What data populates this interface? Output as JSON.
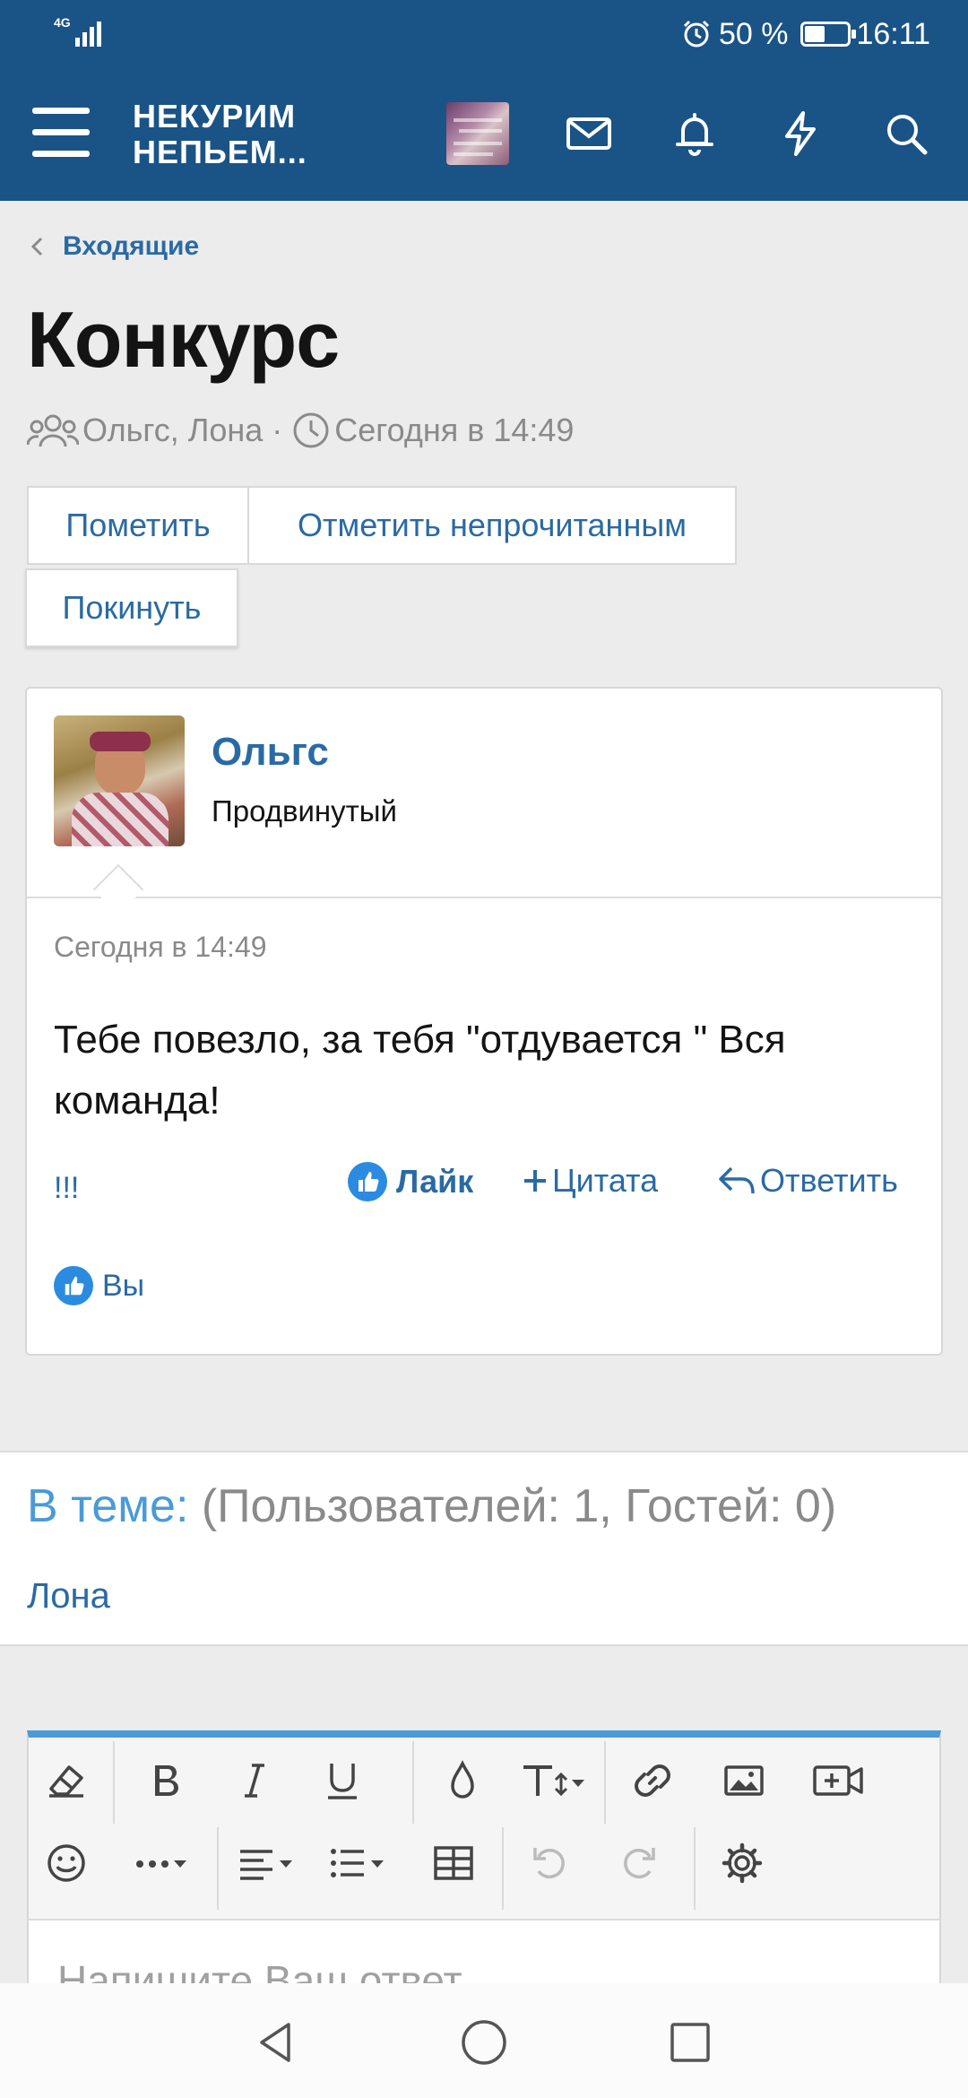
{
  "status_bar": {
    "network": "4G",
    "battery": "50 %",
    "time": "16:11"
  },
  "header": {
    "logo_line1": "НЕКУРИМ",
    "logo_line2": "НЕПЬЕМ...",
    "icons": [
      "menu-icon",
      "avatar",
      "envelope-icon",
      "bell-icon",
      "bolt-icon",
      "search-icon"
    ],
    "accent": "#1a5386"
  },
  "breadcrumb": {
    "label": "Входящие"
  },
  "conversation": {
    "title": "Конкурс",
    "participants": "Ольгс, Лона",
    "separator": "·",
    "time": "Сегодня в 14:49"
  },
  "actions": {
    "mark": "Пометить",
    "mark_unread": "Отметить непрочитанным",
    "leave": "Покинуть"
  },
  "post": {
    "author": "Ольгс",
    "rank": "Продвинутый",
    "date": "Сегодня в 14:49",
    "text": "Тебе повезло, за тебя \"отдувается \" Вся команда!",
    "exclaim": "!!!",
    "like_label": "Лайк",
    "quote_label": "Цитата",
    "reply_label": "Ответить",
    "likes_by": "Вы"
  },
  "online": {
    "label": "В теме:",
    "counts": "(Пользователей: 1, Гостей: 0)",
    "user": "Лона"
  },
  "editor": {
    "placeholder": "Напишите Ваш ответ..."
  }
}
